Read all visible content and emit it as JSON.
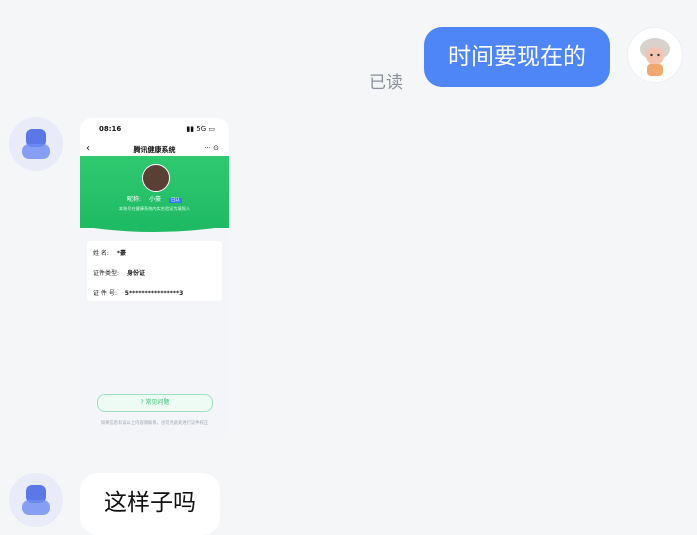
{
  "messages": {
    "sent_text": "时间要现在的",
    "read_status": "已读",
    "received_text": "这样子吗"
  },
  "screenshot": {
    "status_time": "08:16",
    "title": "腾讯健康系统",
    "nickname_label": "昵称:",
    "nickname_value": "小豪",
    "badge": "已认",
    "subtitle": "本账号在健康系统内实名验证为填报人",
    "rows": [
      {
        "label": "姓        名:",
        "value": "*豪"
      },
      {
        "label": "证件类型:",
        "value": "身份证"
      },
      {
        "label": "证  件  号:",
        "value": "5****************3"
      }
    ],
    "faq_button": "常见问题",
    "footer_note": "如果信息有误以上内容请联系，也可点此处进行证件校正"
  },
  "colors": {
    "sent_bubble": "#4f86f7",
    "green_header": "#1fba64"
  }
}
